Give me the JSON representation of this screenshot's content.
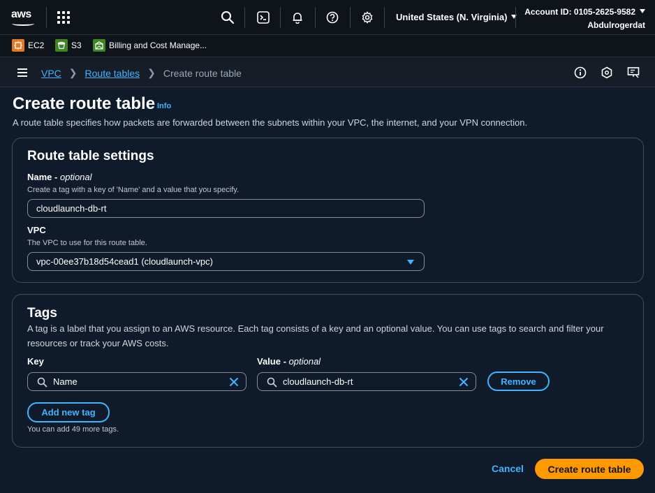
{
  "topnav": {
    "logo_text": "aws",
    "region": "United States (N. Virginia)",
    "account_id": "Account ID: 0105-2625-9582",
    "username": "Abdulrogerdat"
  },
  "favorites": [
    {
      "label": "EC2",
      "color": "#e07b24"
    },
    {
      "label": "S3",
      "color": "#3f8624"
    },
    {
      "label": "Billing and Cost Manage...",
      "color": "#3f8624"
    }
  ],
  "breadcrumb": {
    "vpc": "VPC",
    "route_tables": "Route tables",
    "current": "Create route table"
  },
  "header": {
    "title": "Create route table",
    "info": "Info",
    "description": "A route table specifies how packets are forwarded between the subnets within your VPC, the internet, and your VPN connection."
  },
  "settings": {
    "title": "Route table settings",
    "name_label": "Name",
    "name_optional": "optional",
    "name_desc": "Create a tag with a key of 'Name' and a value that you specify.",
    "name_value": "cloudlaunch-db-rt",
    "vpc_label": "VPC",
    "vpc_desc": "The VPC to use for this route table.",
    "vpc_value": "vpc-00ee37b18d54cead1 (cloudlaunch-vpc)"
  },
  "tags": {
    "title": "Tags",
    "description": "A tag is a label that you assign to an AWS resource. Each tag consists of a key and an optional value. You can use tags to search and filter your resources or track your AWS costs.",
    "key_label": "Key",
    "value_label": "Value",
    "value_optional": "optional",
    "key_value": "Name",
    "value_value": "cloudlaunch-db-rt",
    "remove_label": "Remove",
    "add_label": "Add new tag",
    "hint": "You can add 49 more tags."
  },
  "footer": {
    "cancel": "Cancel",
    "create": "Create route table"
  },
  "colors": {
    "accent": "#42b4ff",
    "primary": "#ff9900",
    "background": "#0f1b2a"
  }
}
